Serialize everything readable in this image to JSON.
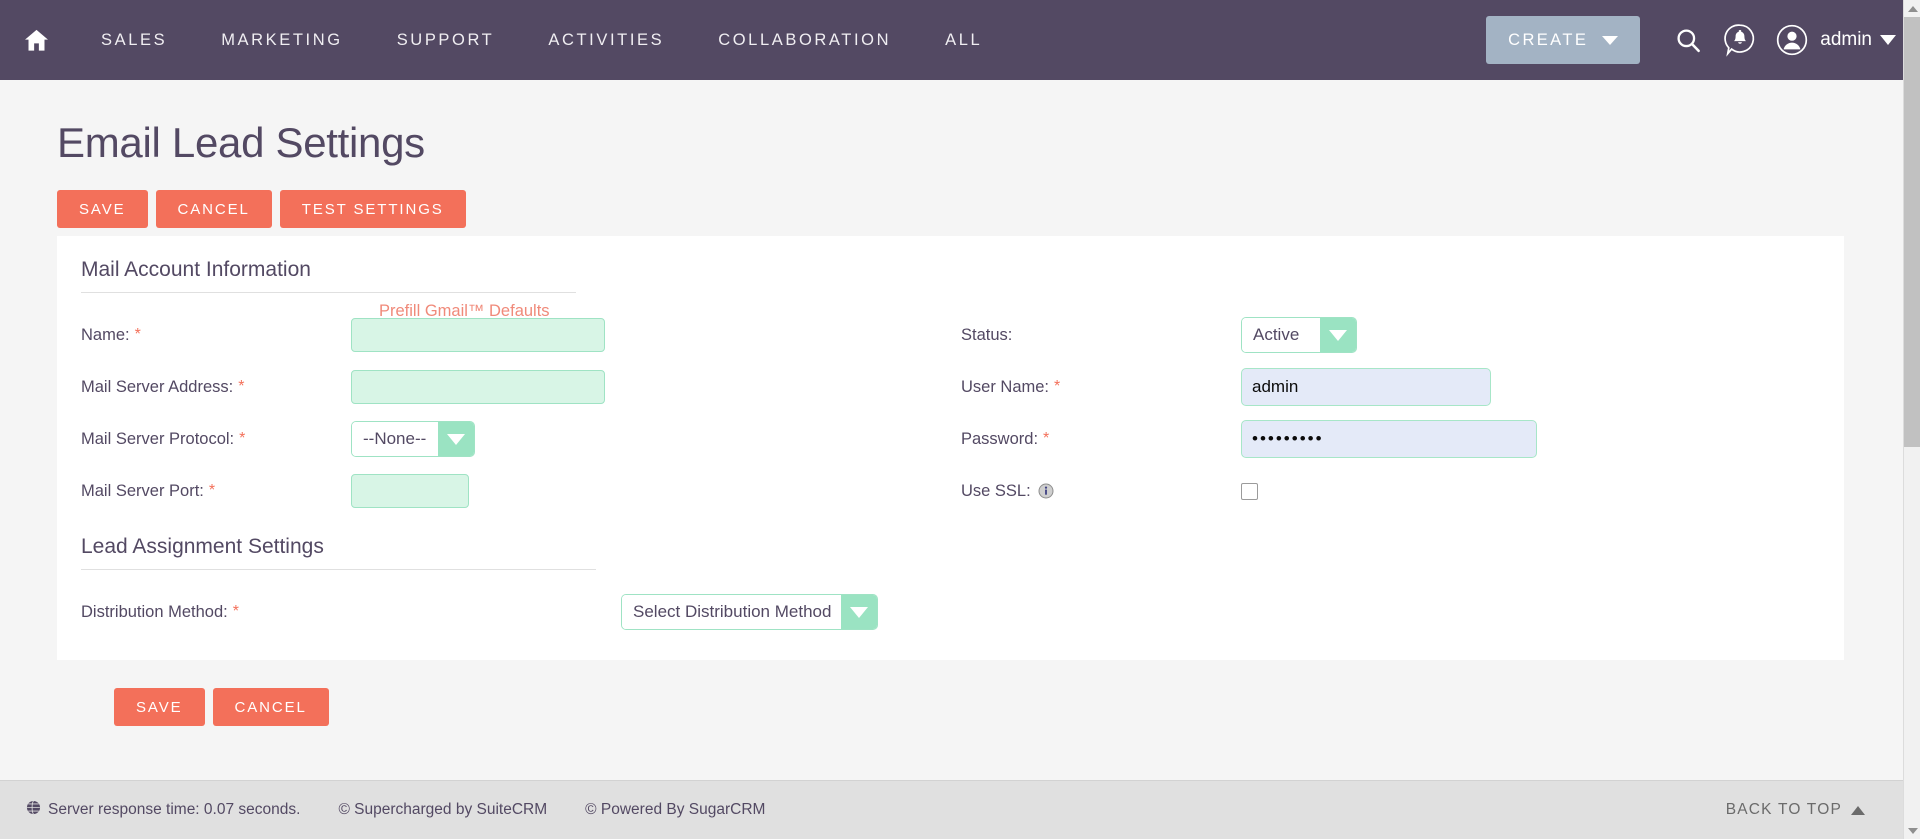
{
  "navbar": {
    "home_icon": "home-icon",
    "links": [
      {
        "label": "SALES"
      },
      {
        "label": "MARKETING"
      },
      {
        "label": "SUPPORT"
      },
      {
        "label": "ACTIVITIES"
      },
      {
        "label": "COLLABORATION"
      },
      {
        "label": "ALL"
      }
    ],
    "create_label": "CREATE",
    "search_icon": "search-icon",
    "notifications_icon": "notification-bell-icon",
    "avatar_icon": "user-avatar-icon",
    "user_label": "admin",
    "bg_color": "#534963",
    "create_bg_color": "#a3b3c4"
  },
  "sidebar_toggle": {
    "icon": "expand-sidebar-arrow-icon"
  },
  "page": {
    "title": "Email Lead Settings"
  },
  "actions_top": {
    "save_label": "SAVE",
    "cancel_label": "CANCEL",
    "test_label": "TEST SETTINGS",
    "button_color": "#f3705a"
  },
  "actions_bottom": {
    "save_label": "SAVE",
    "cancel_label": "CANCEL"
  },
  "mail_account": {
    "section_title": "Mail Account Information",
    "prefill_link": "Prefill Gmail™ Defaults",
    "fields": {
      "name_label": "Name:",
      "name_value": "",
      "server_address_label": "Mail Server Address:",
      "server_address_value": "",
      "server_protocol_label": "Mail Server Protocol:",
      "server_protocol_value": "--None--",
      "server_port_label": "Mail Server Port:",
      "server_port_value": "",
      "status_label": "Status:",
      "status_value": "Active",
      "user_name_label": "User Name:",
      "user_name_value": "admin",
      "password_label": "Password:",
      "password_value": "•••••••••",
      "use_ssl_label": "Use SSL:",
      "use_ssl_checked": false,
      "info_icon": "info-icon"
    },
    "required_marker": "*"
  },
  "lead_assignment": {
    "section_title": "Lead Assignment Settings",
    "distribution_method_label": "Distribution Method:",
    "distribution_method_value": "Select Distribution Method"
  },
  "footer": {
    "globe_icon": "globe-icon",
    "server_response": "Server response time: 0.07 seconds.",
    "supercharged": "© Supercharged by SuiteCRM",
    "powered": "© Powered By SugarCRM",
    "back_to_top": "BACK TO TOP"
  }
}
